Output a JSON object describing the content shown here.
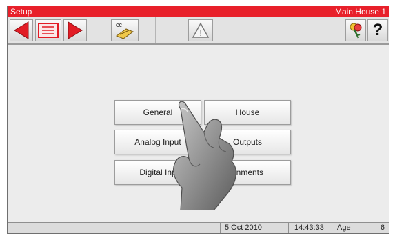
{
  "title_bar": {
    "screen_title": "Setup",
    "location": "Main House 1"
  },
  "toolbar": {
    "back_icon": "triangle-left-icon",
    "list_icon": "list-icon",
    "forward_icon": "triangle-right-icon",
    "cc_icon": "cc-tool-icon",
    "cc_label": "cc",
    "alarm_icon": "warning-icon",
    "alarm_glyph": "!",
    "keys_icon": "keys-icon",
    "help_glyph": "?"
  },
  "menu": {
    "general": "General",
    "house": "House",
    "analog_inputs": "Analog Input",
    "outputs": "Outputs",
    "digital_inputs": "Digital Inp",
    "assignments": "gnments"
  },
  "status": {
    "date": "5 Oct 2010",
    "time": "14:43:33",
    "age_label": "Age",
    "age_value": "6"
  },
  "colors": {
    "title_bg": "#e8202a",
    "arrow_red": "#e21c25"
  }
}
